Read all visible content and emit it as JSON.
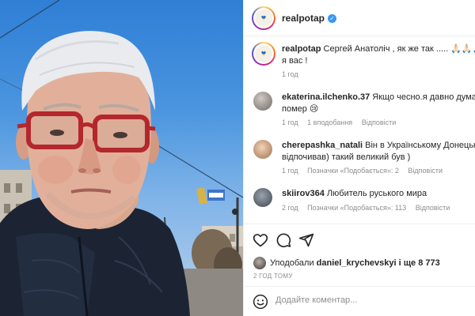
{
  "post": {
    "username": "realpotap",
    "verified_mark": "✓"
  },
  "caption": {
    "username": "realpotap",
    "text_line1": "Сергей Анатоліч , як же так ..... 🙏🏻🙏🏻🙏🏻 R.I.P",
    "text_line2": "я вас !",
    "time": "1 год"
  },
  "comments": [
    {
      "username": "ekaterina.ilchenko.37",
      "text_line1": "Якщо чесно.я давно думала що він",
      "text_line2": "помер 😢",
      "time": "1 год",
      "likes": "1 вподобання",
      "reply": "Відповісти"
    },
    {
      "username": "cherepashka_natali",
      "text_line1": "Він в Українському Донецьку у клубі",
      "text_line2": "відпочивав) такий великий був )",
      "time": "1 год",
      "likes": "Позначки «Подобається»: 2",
      "reply": "Відповісти"
    },
    {
      "username": "skiirov364",
      "text_line1": "Любитель руського мира",
      "time": "2 год",
      "likes": "Позначки «Подобається»: 113",
      "reply": "Відповісти"
    }
  ],
  "icons": {
    "like": "heart-outline-icon",
    "comment": "speech-bubble-icon",
    "share": "paper-plane-icon",
    "emoji": "smiley-icon"
  },
  "liked_by": {
    "prefix": "Уподобали",
    "user": "daniel_krychevskyi",
    "suffix": "і ще 8 773"
  },
  "time_ago": "2 ГОД ТОМУ",
  "add_comment": {
    "placeholder": "Додайте коментар..."
  },
  "colors": {
    "verified": "#3897f0",
    "meta_gray": "#8e8e8e",
    "text": "#262626"
  }
}
